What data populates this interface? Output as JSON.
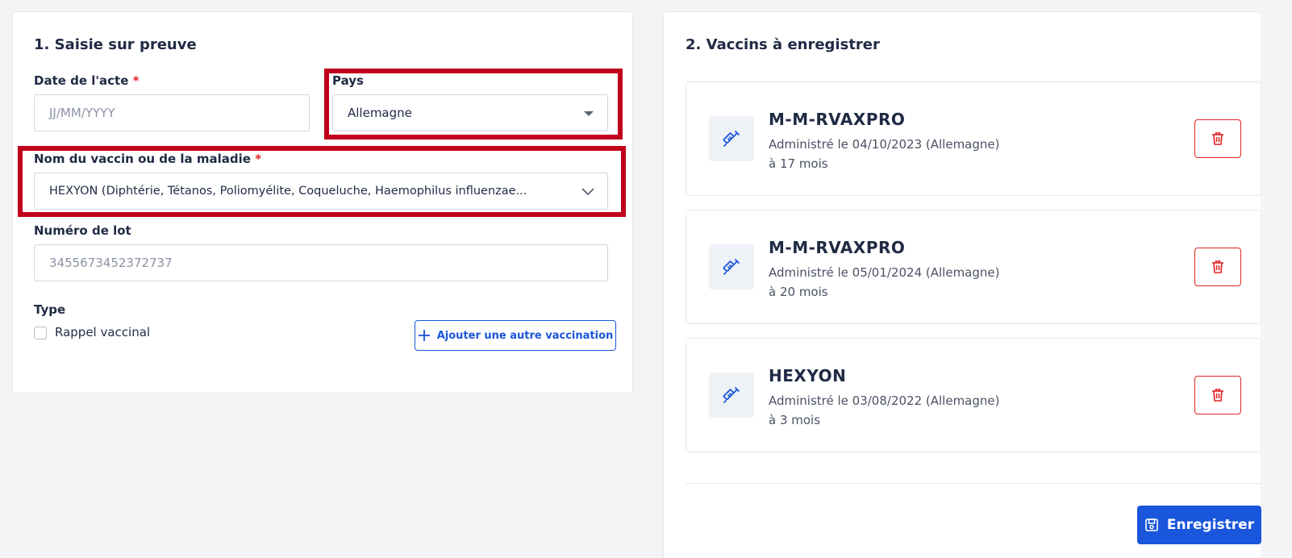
{
  "left": {
    "title": "1. Saisie sur preuve",
    "date_label": "Date de l'acte",
    "date_required": "*",
    "date_placeholder": "JJ/MM/YYYY",
    "country_label": "Pays",
    "country_value": "Allemagne",
    "vaccine_label": "Nom du vaccin ou de la maladie",
    "vaccine_required": "*",
    "vaccine_value": "HEXYON (Diphtérie, Tétanos, Poliomyélite, Coqueluche, Haemophilus influenzae...",
    "lot_label": "Numéro de lot",
    "lot_placeholder": "3455673452372737",
    "type_label": "Type",
    "booster_label": "Rappel vaccinal",
    "add_button_label": "Ajouter une autre vaccination"
  },
  "right": {
    "title": "2. Vaccins à enregistrer",
    "cards": [
      {
        "name": "M-M-RVAXPRO",
        "administered": "Administré le 04/10/2023 (Allemagne)",
        "age": "à 17 mois"
      },
      {
        "name": "M-M-RVAXPRO",
        "administered": "Administré le 05/01/2024 (Allemagne)",
        "age": "à 20 mois"
      },
      {
        "name": "HEXYON",
        "administered": "Administré le 03/08/2022 (Allemagne)",
        "age": "à 3 mois"
      }
    ],
    "save_label": "Enregistrer"
  },
  "colors": {
    "primary": "#1a56db",
    "danger": "#e02424",
    "highlight": "#c0001a"
  },
  "icons": {
    "card_icon": "syringe-icon",
    "delete_icon": "trash-icon",
    "add_icon": "plus-icon",
    "save_icon": "save-icon"
  }
}
